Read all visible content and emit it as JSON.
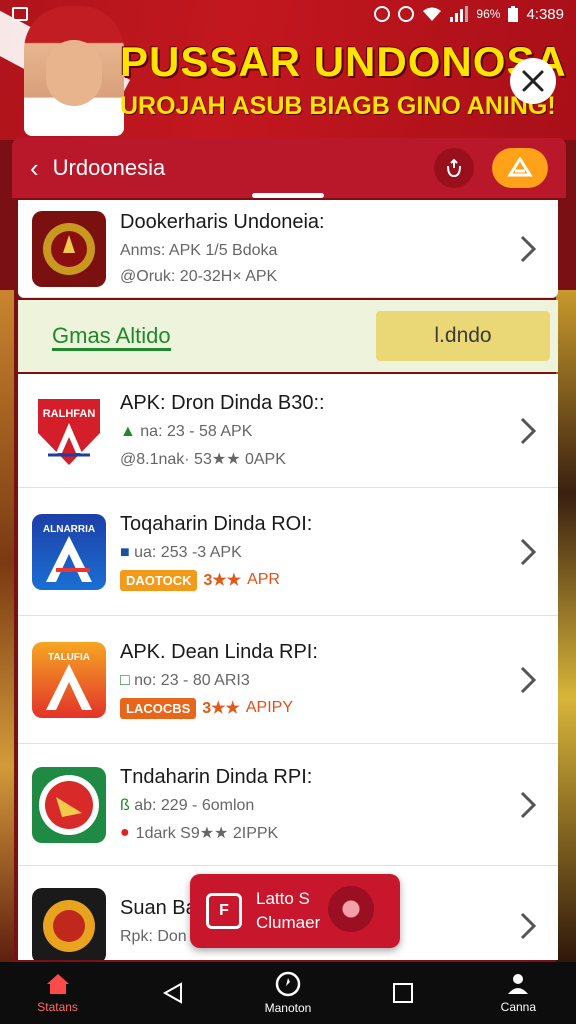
{
  "status_bar": {
    "battery": "96%",
    "time": "4:389"
  },
  "banner": {
    "title": "PUSSAR UNDONOSA",
    "subtitle": "UROJAH ASUB BIAGB GINO ANING!"
  },
  "header": {
    "title": "Urdoonesia"
  },
  "list": {
    "top_item": {
      "name": "Dookerharis Undoneia:",
      "line1": "Anms: APK 1/5 Bdoka",
      "line2": "@Oruk: 20-32H× APK"
    },
    "promo": {
      "label": "Gmas Altido",
      "button": "l.dndo"
    },
    "items": [
      {
        "name": "APK: Dron Dinda B30::",
        "line1": "na: 23 - 58 APK",
        "line2": "@8.1nak· 53★★ 0APK",
        "icon_text": "RALHFAN"
      },
      {
        "name": "Toqaharin Dinda ROI:",
        "line1": "ua: 253 -3 APK",
        "badge": "DAOTOCK",
        "stars": "3★★",
        "tag": "APR",
        "icon_text": "ALNARRIA"
      },
      {
        "name": "APK. Dean Linda RPI:",
        "line1": "no: 23 - 80 ARI3",
        "badge": "LACOCBS",
        "stars": "3★★",
        "tag": "APIPY",
        "icon_text": "TALUFIA"
      },
      {
        "name": "Tndaharin Dinda RPI:",
        "line1": "ab: 229 - 6omlon",
        "line2": "1dark S9★★ 2IPPK"
      },
      {
        "name": "Suan Bar",
        "line1": "Rpk: Don"
      }
    ]
  },
  "toast": {
    "line1": "Latto S",
    "line2": "Clumaer"
  },
  "bottom_nav": {
    "home": "Statans",
    "center": "Manoton",
    "profile": "Canna"
  },
  "colors": {
    "primary_red": "#b8182a",
    "accent_orange": "#ffa21a",
    "promo_green": "#1e8a2a",
    "banner_yellow": "#ffe400"
  }
}
